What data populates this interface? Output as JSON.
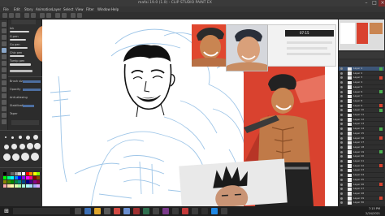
{
  "app": {
    "title": "mafai 19.0 (1.0) - CLIP STUDIO PAINT EX",
    "window_controls": [
      "minimize-icon",
      "maximize-icon",
      "close-icon"
    ]
  },
  "menubar": {
    "items": [
      "File",
      "Edit",
      "Story",
      "Animation",
      "Layer",
      "Select",
      "View",
      "Filter",
      "Window",
      "Help"
    ]
  },
  "subtool": {
    "items": [
      "Ink",
      "G-pen",
      "Gu pen",
      "Chiz pen",
      "Turnip pen"
    ]
  },
  "toolprop": {
    "labels": [
      "Brush size",
      "Opacity",
      "Anti-aliasing",
      "Stabilization",
      "Taper"
    ],
    "values": [
      "6.0",
      "100",
      "",
      "24",
      ""
    ]
  },
  "reference_window": {
    "clock": "07:15"
  },
  "layers": {
    "items": [
      "Layer 1",
      "Layer 2",
      "Layer 3",
      "Layer 4",
      "Layer 5",
      "Layer 6",
      "Layer 7",
      "Layer 8",
      "Layer 9",
      "Layer 10",
      "Layer 11",
      "Layer 12",
      "Layer 13",
      "Layer 14",
      "Layer 15",
      "Layer 16",
      "Layer 17",
      "Layer 18",
      "Layer 19",
      "Layer 20",
      "Layer 21",
      "Layer 22",
      "Layer 23",
      "Layer 24",
      "Layer 25",
      "Layer 26",
      "Layer 27",
      "Layer 28",
      "Layer 29",
      "Layer 30"
    ]
  },
  "taskbar": {
    "time": "7:15 PM",
    "date": "2/24/2021"
  },
  "colors": {
    "accent": "#4d6ea0",
    "active_tool": "#8aa7c9",
    "reference_red": "#d9422f"
  }
}
